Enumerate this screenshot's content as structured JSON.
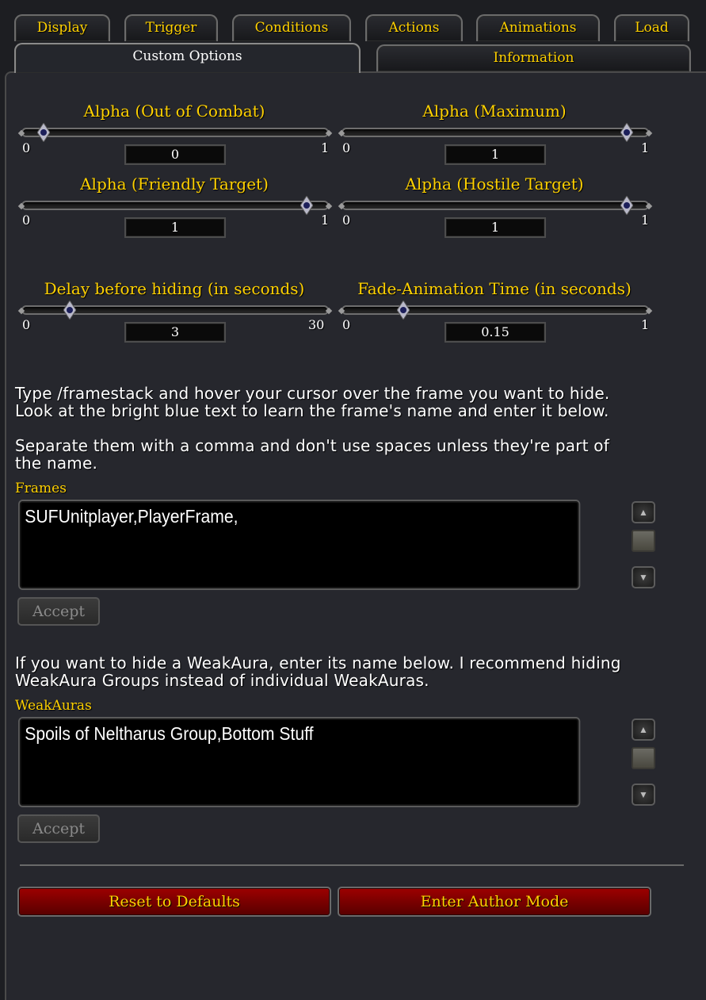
{
  "tabs": {
    "display": "Display",
    "trigger": "Trigger",
    "conditions": "Conditions",
    "actions": "Actions",
    "animations": "Animations",
    "load": "Load",
    "custom_options": "Custom Options",
    "information": "Information"
  },
  "sliders": [
    {
      "label": "Alpha (Out of Combat)",
      "min": "0",
      "max": "1",
      "value": "0",
      "fraction": 0.0
    },
    {
      "label": "Alpha (Maximum)",
      "min": "0",
      "max": "1",
      "value": "1",
      "fraction": 1.0
    },
    {
      "label": "Alpha (Friendly Target)",
      "min": "0",
      "max": "1",
      "value": "1",
      "fraction": 1.0
    },
    {
      "label": "Alpha (Hostile Target)",
      "min": "0",
      "max": "1",
      "value": "1",
      "fraction": 1.0
    },
    {
      "label": "Delay before hiding (in seconds)",
      "min": "0",
      "max": "30",
      "value": "3",
      "fraction": 0.1
    },
    {
      "label": "Fade-Animation Time (in seconds)",
      "min": "0",
      "max": "1",
      "value": "0.15",
      "fraction": 0.15
    }
  ],
  "instructions": {
    "line1": "Type /framestack and hover your cursor over the frame you want to hide.",
    "line2": "Look at the bright blue text to learn the frame's name and enter it below.",
    "line3": "Separate them with a comma and don't use spaces unless they're part of",
    "line4": "the name."
  },
  "frames": {
    "label": "Frames",
    "value": "SUFUnitplayer,PlayerFrame,",
    "accept": "Accept"
  },
  "weakaura_info": {
    "line1": "If you want to hide a WeakAura, enter its name below. I recommend hiding",
    "line2": "WeakAura Groups instead of individual WeakAuras."
  },
  "weakauras": {
    "label": "WeakAuras",
    "value": "Spoils of Neltharus Group,Bottom Stuff",
    "accept": "Accept"
  },
  "buttons": {
    "reset": "Reset to Defaults",
    "author": "Enter Author Mode"
  },
  "colors": {
    "gold": "#ffd100",
    "button_red": "#8a0000",
    "background": "#26272d"
  }
}
